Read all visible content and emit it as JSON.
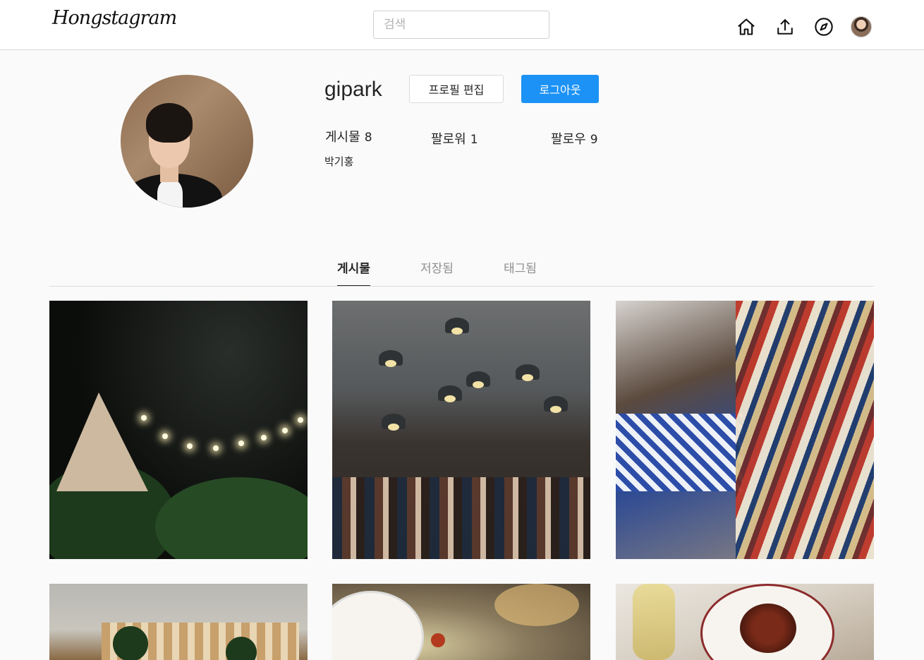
{
  "header": {
    "logo": "Hongstagram",
    "search_placeholder": "검색",
    "icons": [
      "home-icon",
      "upload-icon",
      "explore-compass-icon",
      "profile-avatar"
    ]
  },
  "profile": {
    "username": "gipark",
    "edit_label": "프로필 편집",
    "logout_label": "로그아웃",
    "stats": {
      "posts_label": "게시물",
      "posts_count": "8",
      "followers_label": "팔로워",
      "followers_count": "1",
      "following_label": "팔로우",
      "following_count": "9"
    },
    "real_name": "박기홍"
  },
  "tabs": [
    {
      "label": "게시물",
      "active": true
    },
    {
      "label": "저장됨",
      "active": false
    },
    {
      "label": "태그됨",
      "active": false
    }
  ],
  "colors": {
    "accent": "#1c92f6",
    "border": "#dbdbdb",
    "background": "#fafafa",
    "muted_text": "#8e8e8e"
  }
}
